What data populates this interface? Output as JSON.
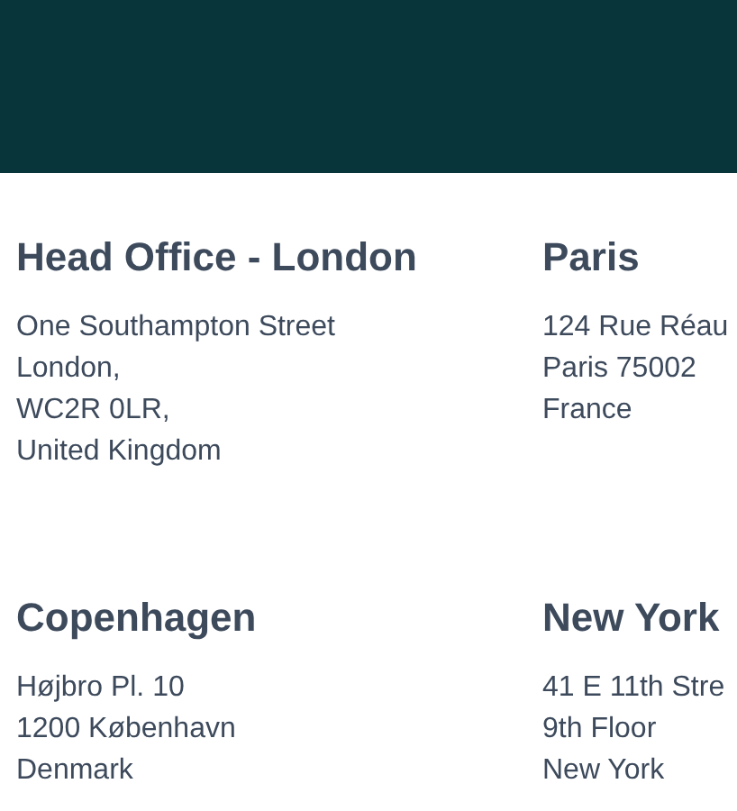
{
  "offices": [
    {
      "name": "Head Office - London",
      "lines": [
        "One Southampton Street",
        "London,",
        "WC2R 0LR,",
        "United Kingdom"
      ]
    },
    {
      "name": "Paris",
      "lines": [
        "124 Rue Réau",
        "Paris 75002",
        "France"
      ]
    },
    {
      "name": "Copenhagen",
      "lines": [
        "Højbro Pl. 10",
        "1200 København",
        "Denmark"
      ]
    },
    {
      "name": "New York",
      "lines": [
        "41 E 11th Stre",
        "9th Floor",
        "New York"
      ]
    }
  ]
}
